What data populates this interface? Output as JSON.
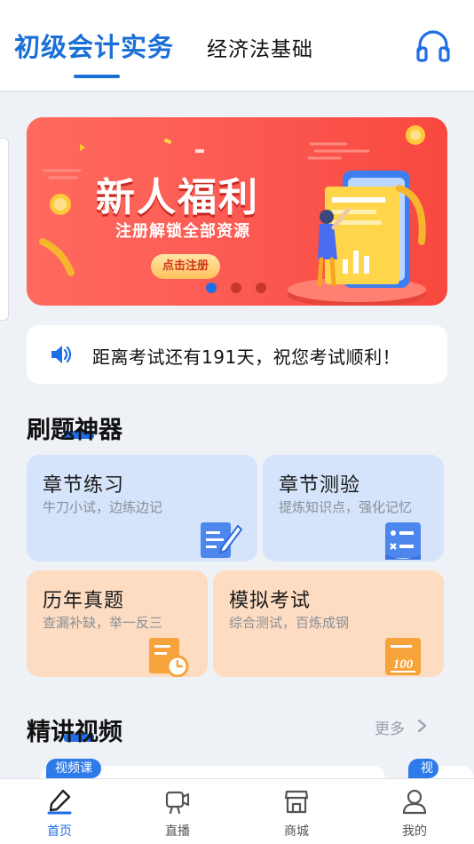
{
  "header": {
    "tabs": [
      {
        "label": "初级会计实务",
        "active": true
      },
      {
        "label": "经济法基础",
        "active": false
      }
    ],
    "headset_icon": "headset-icon"
  },
  "banner": {
    "title": "新人福利",
    "subtitle": "注册解锁全部资源",
    "button_label": "点击注册",
    "carousel_current": 1,
    "carousel_total": 3
  },
  "notice": {
    "icon": "speaker-icon",
    "text": "距离考试还有191天，祝您考试顺利！"
  },
  "practice": {
    "title": "刷题神器",
    "cards": [
      {
        "title": "章节练习",
        "subtitle": "牛刀小试，边练边记",
        "icon": "pencil-doc-icon",
        "color": "#d5e4fb"
      },
      {
        "title": "章节测验",
        "subtitle": "提炼知识点，强化记忆",
        "icon": "quiz-sheet-icon",
        "color": "#d5e4fb"
      },
      {
        "title": "历年真题",
        "subtitle": "查漏补缺，举一反三",
        "icon": "clock-doc-icon",
        "color": "#fddcc2"
      },
      {
        "title": "模拟考试",
        "subtitle": "综合测试，百炼成钢",
        "icon": "score-100-icon",
        "color": "#fddcc2"
      }
    ]
  },
  "videos": {
    "title": "精讲视频",
    "more_label": "更多",
    "badges": [
      "视频课",
      "视"
    ]
  },
  "bottom_nav": {
    "items": [
      {
        "label": "首页",
        "icon": "home-pen-icon",
        "active": true
      },
      {
        "label": "直播",
        "icon": "live-camera-icon",
        "active": false
      },
      {
        "label": "商城",
        "icon": "shop-icon",
        "active": false
      },
      {
        "label": "我的",
        "icon": "profile-icon",
        "active": false
      }
    ]
  },
  "colors": {
    "accent": "#1f6ee6",
    "banner_red": "#fb5a52",
    "card_blue": "#d5e4fb",
    "card_orange": "#fddcc2"
  }
}
